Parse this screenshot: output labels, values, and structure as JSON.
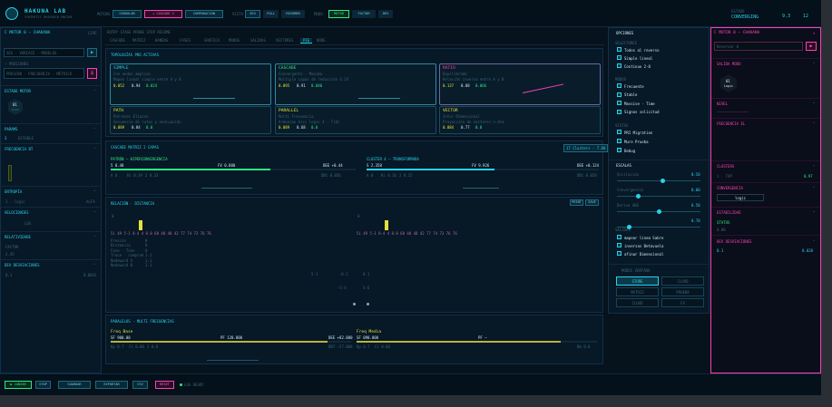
{
  "header": {
    "brand_title": "HAKUNA LAB",
    "brand_subtitle": "SYNTHETIC RESEARCH ENGINE",
    "motors_label": "MOTORS",
    "motor_btns": [
      "SINGULAR",
      "+ CASCADE 2",
      "COMPARACIÓN"
    ],
    "view_label": "VISTA",
    "view_btns": [
      "SEG",
      "FULL",
      "RESUMEN"
    ],
    "mode_label": "MODO",
    "mode_btns": [
      "MOTOR",
      "FACTOR",
      "DEV"
    ],
    "right_label": "ESTADO",
    "right_value": "CONVERGING",
    "right_stats": [
      "9.3",
      "12"
    ]
  },
  "left": {
    "title": "C MOTOR 0 — CHAKANA",
    "title_tag": "LIVE",
    "search_ph": "SEG · VARIACE · MODELOS",
    "search_tag": "⋯ PRESIONES",
    "input2_ph": "PRESIÓN · FRECUENCIA · MÉTRICA",
    "section_model": "ESTADO MOTOR",
    "hex_label": "01",
    "hex_sub": "SEGUR",
    "section_params": "PARAMS",
    "param_row": "3",
    "param_row_val": "ESTABLE",
    "section_freq": "FRECUENCIA BT",
    "section_entropy": "ENTROPÍA",
    "entropy_val": "1 · logic",
    "entropy_right": "ALFA",
    "section_vel": "VELOCIDADES",
    "vel_val": "LOG",
    "section_rel": "RELATIVIDADE",
    "rel_v1": "FACTOR",
    "rel_v2": "2.45",
    "section_dev": "DEV DESVIACIONES",
    "dev_v1": "0.1",
    "dev_v2": "0.0041"
  },
  "tabs": {
    "meta": "ENTRY  STAGE  PROBE  STOP  RESUME",
    "items": [
      "CASCADE",
      "MATRIZ",
      "BANDAS",
      "FASES",
      "GRÁFICO",
      "MODOS",
      "SALIDAS",
      "VECTORES",
      "PIE",
      "NODE"
    ],
    "active": 8
  },
  "topologies": {
    "title": "TOPOLOGÍAS PRO ACTIVAS",
    "cards": [
      {
        "name": "SIMPLE",
        "sub": "Con ondas amplias",
        "desc": "Mapeo lineal simple entre A y B",
        "m1": "0.052",
        "m2": "0.94",
        "m3": "0.024"
      },
      {
        "name": "CASCADE",
        "sub": "Convergente · Maxima",
        "desc": "Multiple capas de reducción 4.24",
        "m1": "0.095",
        "m2": "0.91",
        "m3": "0.040"
      },
      {
        "name": "RATIO",
        "sub": "Equilibrado",
        "desc": "Relación inversa entre A y B",
        "m1": "0.137",
        "m2": "0.88",
        "m3": "0.066"
      },
      {
        "name": "PATH",
        "sub": "Patrones Eliasso",
        "desc": "Secuencia de rutas y evaluación",
        "m1": "0.089",
        "m2": "0.84",
        "m3": "0.0"
      },
      {
        "name": "PARALLEL",
        "sub": "Multi Frecuencia",
        "desc": "Armonías A(x) logic 4 · T(0)",
        "m1": "0.089",
        "m2": "0.68",
        "m3": "0.0"
      },
      {
        "name": "VECTOR",
        "sub": "Inter Dimensional",
        "desc": "Proyección de vectores n-dim",
        "m1": "0.084",
        "m2": "0.77",
        "m3": "0.0"
      }
    ]
  },
  "cascade": {
    "title": "CASCADE MATRIZ 2 CAPAS",
    "tag": "17 Clusters · 7.80",
    "left_name": "PATRÓN — HIPERCONVERGENCIA",
    "right_name": "CLUSTER 4 — TRANSFORMADA",
    "left_stats": [
      "5  0.48",
      "FV  0.880",
      "DEE  +0.44"
    ],
    "left_stats2": [
      "A 0",
      "Ki 0.39",
      "2  0.33",
      "DBt  0.056"
    ],
    "right_stats": [
      "S  2.358",
      "FV  9.926",
      "DEE  +0.124"
    ],
    "right_stats2": [
      "A 0",
      "Ki 0.16",
      "2  0.15",
      "DBt  0.058"
    ],
    "left_fill": 0.65,
    "right_fill": 0.55
  },
  "relations": {
    "title": "RELACIÓN · DISTANCIA",
    "btns": [
      "PRINT",
      "SAVE"
    ],
    "left_row": "5i  49  5·1  8·4  4   8.8   68  40  48  42  77  74  73  76  76",
    "right_row": "5i  49  5·1  8·4  4   8.8   68  40  48  42  77  74  73  76  76",
    "labels": [
      "Presión",
      "Distancia",
      "Fase · Tono",
      "Trace · comprom",
      "Nodeward A",
      "Nodeward B"
    ],
    "label_vals": [
      "0",
      "0",
      "0",
      "1.1",
      "1.1",
      "1.1"
    ],
    "center_vals": [
      "5·1",
      "−6·2",
      "0.1",
      "−5·4",
      "5·6"
    ]
  },
  "parallel": {
    "title": "PARALELOS · MULTI FRECUENCIAS",
    "left_name": "Freq Base",
    "right_name": "Freq Media",
    "left_stats": [
      "SF  900.00",
      "PF  120.000",
      "DEE  +82.000"
    ],
    "left_stats2": [
      "Kp 0.7",
      "Ci 0.00",
      "2  0.0"
    ],
    "right_stats": [
      "SF  090.000",
      "PF  —",
      ""
    ],
    "right_stats2": [
      "Kp 0.7",
      "Ci 0.00",
      "DBT  −27.000",
      "Bb 0.0"
    ],
    "left_fill": 0.9,
    "right_fill": 0.85
  },
  "options": {
    "title": "OPCIONES",
    "group1_label": "SELECTORES",
    "group1": [
      "Todos al reverso",
      "Simple lineal",
      "Continuo 2·8"
    ],
    "group2_label": "MODOS",
    "group2": [
      "Frecuente",
      "Stable",
      "Massive · Time",
      "Signos solicitud"
    ],
    "group3_label": "VISTAS",
    "group3": [
      "PRI Migration",
      "Muro Prueba",
      "Debug"
    ],
    "scale_title": "ESCALAS",
    "sliders": [
      {
        "label": "Oscilación",
        "value": "0.50",
        "pos": 0.55
      },
      {
        "label": "Convergencia",
        "value": "0.00",
        "pos": 0.25
      },
      {
        "label": "Deriva ABG",
        "value": "0.50",
        "pos": 0.5
      },
      {
        "label": "",
        "value": "0.70",
        "pos": 0.15
      }
    ],
    "outputs_label": "SALIDAS",
    "outputs": [
      "mapear linea Sabre",
      "inversas Betavuela",
      "afinar Dimensional"
    ],
    "grid_title": "MODOS VENTANA",
    "grid": [
      "STORE",
      "CLOUD",
      "MATRIZ",
      "PRUEBA",
      "CLOUD",
      "FX"
    ]
  },
  "right": {
    "title": "C MOTOR 0 — CHAKANA",
    "search_ph": "Reservar 0",
    "sec1": "SALIDA MODO",
    "hex_label": "01",
    "hex_sub": "Logic",
    "sec2": "NIVEL",
    "sec3": "FRECUENCIA EL",
    "sec4": "CLUSTERS",
    "sec4_left": "1 · TOP",
    "sec4_val": "0.97",
    "sec5": "CONVERGENCIA",
    "sec5_val": "logic",
    "sec6": "ESTABILIDAD",
    "sec6_sub": "STATUS",
    "sec6_val": "0.00",
    "sec7": "DEV DESVIACIONES",
    "sec7_left": "0.1",
    "sec7_val": "0.020"
  },
  "footer": {
    "btn1": "▶ LANZAR",
    "btn2": "STOP",
    "btns": [
      "GUARDAR",
      "EXPORTAR",
      "CSV"
    ],
    "btn_pink": "RESET",
    "status": "LOG  READY"
  },
  "colors": {
    "accent": "#27d3e8",
    "pink": "#ff3fb4",
    "green": "#2ee882",
    "yellow": "#e6e13a"
  }
}
